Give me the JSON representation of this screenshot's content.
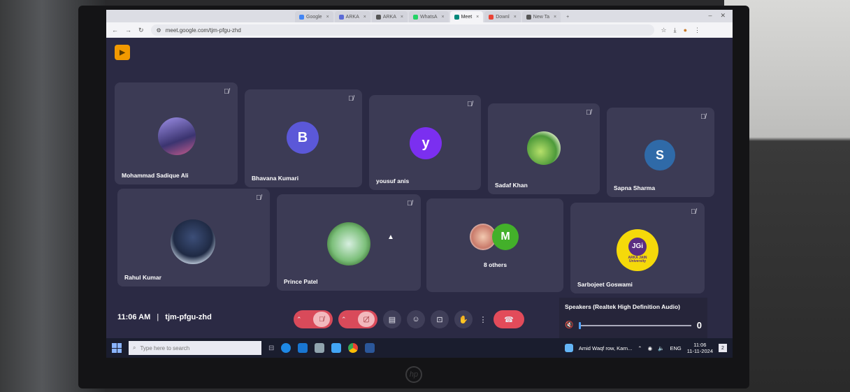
{
  "browser": {
    "tabs": [
      {
        "label": "Google",
        "color": "#4285f4"
      },
      {
        "label": "ARKA",
        "color": "#5b6bd6"
      },
      {
        "label": "ARKA",
        "color": "#555555"
      },
      {
        "label": "WhatsA",
        "color": "#25d366"
      },
      {
        "label": "Meet",
        "color": "#00897b",
        "active": true
      },
      {
        "label": "Downl",
        "color": "#ea4335"
      },
      {
        "label": "New Ta",
        "color": "#555555"
      }
    ],
    "new_tab": "+",
    "url": "meet.google.com/tjm-pfgu-zhd",
    "minimize": "–",
    "close": "✕"
  },
  "participants_row1": [
    {
      "name": "Mohammad Sadique Ali",
      "avatar_type": "photo",
      "avatar_color": "#7a6cc9"
    },
    {
      "name": "Bhavana Kumari",
      "avatar_type": "letter",
      "letter": "B",
      "avatar_color": "#5b58d8"
    },
    {
      "name": "yousuf anis",
      "avatar_type": "letter",
      "letter": "y",
      "avatar_color": "#7b2ff0"
    },
    {
      "name": "Sadaf Khan",
      "avatar_type": "photo",
      "avatar_color": "#6cb35a"
    },
    {
      "name": "Sapna Sharma",
      "avatar_type": "letter",
      "letter": "S",
      "avatar_color": "#2f6aa8"
    }
  ],
  "participants_row2": [
    {
      "name": "Rahul Kumar",
      "avatar_type": "photo",
      "avatar_color": "#5a7fb0"
    },
    {
      "name": "Prince Patel",
      "avatar_type": "photo",
      "avatar_color": "#6aa86a"
    },
    {
      "name": "8 others",
      "avatar_type": "group",
      "letter": "M",
      "avatar_color": "#43b02a"
    },
    {
      "name": "Sarbojeet Goswami",
      "avatar_type": "logo",
      "logo_text": "JGi",
      "logo_sub": "ARKA JAIN University",
      "avatar_color": "#f5d90a"
    }
  ],
  "meeting": {
    "time": "11:06 AM",
    "separator": "|",
    "code": "tjm-pfgu-zhd"
  },
  "speaker_popup": {
    "title": "Speakers (Realtek High Definition Audio)",
    "volume": 0,
    "volume_label": "0"
  },
  "taskbar": {
    "search_placeholder": "Type here to search",
    "weather": "Amid Waqf row, Karn...",
    "lang": "ENG",
    "time": "11:06",
    "date": "11-11-2024",
    "notifications": "2"
  }
}
